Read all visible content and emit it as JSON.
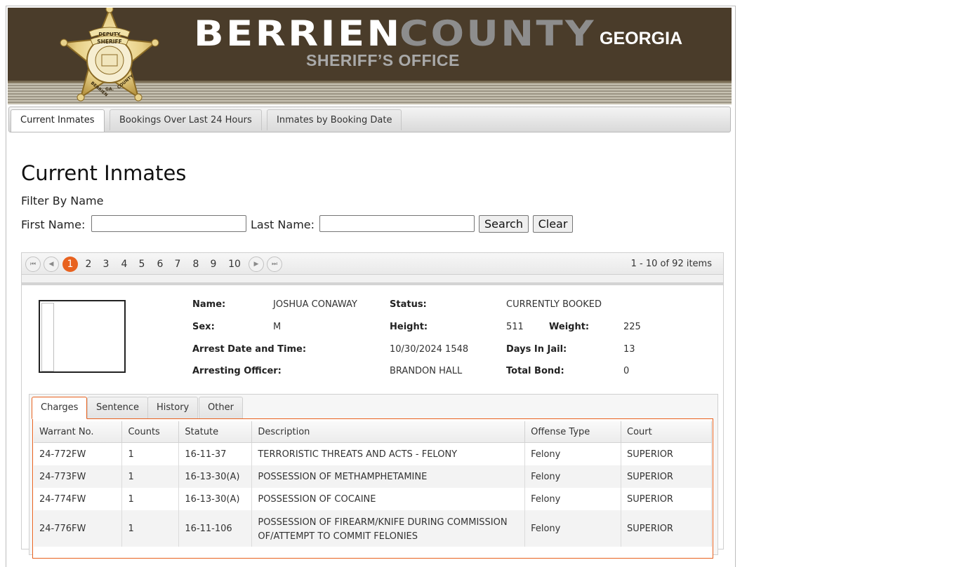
{
  "header": {
    "title_berrien": "BERRIEN",
    "title_county": "COUNTY",
    "title_state": "GEORGIA",
    "subtitle": "SHERIFF’S OFFICE",
    "badge_text": [
      "DEPUTY",
      "SHERIFF",
      "BERRIEN",
      "GA.",
      "COUNTY"
    ]
  },
  "nav_tabs": [
    "Current Inmates",
    "Bookings Over Last 24 Hours",
    "Inmates by Booking Date"
  ],
  "page_title": "Current Inmates",
  "filter": {
    "label": "Filter By Name",
    "first_name_label": "First Name:",
    "last_name_label": "Last Name:",
    "first_name_value": "",
    "last_name_value": "",
    "search_label": "Search",
    "clear_label": "Clear"
  },
  "pager": {
    "pages": [
      "1",
      "2",
      "3",
      "4",
      "5",
      "6",
      "7",
      "8",
      "9",
      "10"
    ],
    "current": "1",
    "info": "1 - 10 of 92 items"
  },
  "inmate": {
    "name_label": "Name:",
    "name": "JOSHUA CONAWAY",
    "status_label": "Status:",
    "status": "CURRENTLY BOOKED",
    "sex_label": "Sex:",
    "sex": "M",
    "height_label": "Height:",
    "height": "511",
    "weight_label": "Weight:",
    "weight": "225",
    "arrest_label": "Arrest Date and Time:",
    "arrest": "10/30/2024 1548",
    "days_label": "Days In Jail:",
    "days": "13",
    "officer_label": "Arresting Officer:",
    "officer": "BRANDON HALL",
    "bond_label": "Total Bond:",
    "bond": "0"
  },
  "detail_tabs": [
    "Charges",
    "Sentence",
    "History",
    "Other"
  ],
  "charges": {
    "columns": [
      "Warrant No.",
      "Counts",
      "Statute",
      "Description",
      "Offense Type",
      "Court"
    ],
    "rows": [
      [
        "24-772FW",
        "1",
        "16-11-37",
        "TERRORISTIC THREATS AND ACTS - FELONY",
        "Felony",
        "SUPERIOR"
      ],
      [
        "24-773FW",
        "1",
        "16-13-30(A)",
        "POSSESSION OF METHAMPHETAMINE",
        "Felony",
        "SUPERIOR"
      ],
      [
        "24-774FW",
        "1",
        "16-13-30(A)",
        "POSSESSION OF COCAINE",
        "Felony",
        "SUPERIOR"
      ],
      [
        "24-776FW",
        "1",
        "16-11-106",
        "POSSESSION OF FIREARM/KNIFE DURING COMMISSION OF/ATTEMPT TO COMMIT FELONIES",
        "Felony",
        "SUPERIOR"
      ]
    ]
  },
  "colors": {
    "banner": "#4a3c2a",
    "accent": "#e8621f"
  }
}
